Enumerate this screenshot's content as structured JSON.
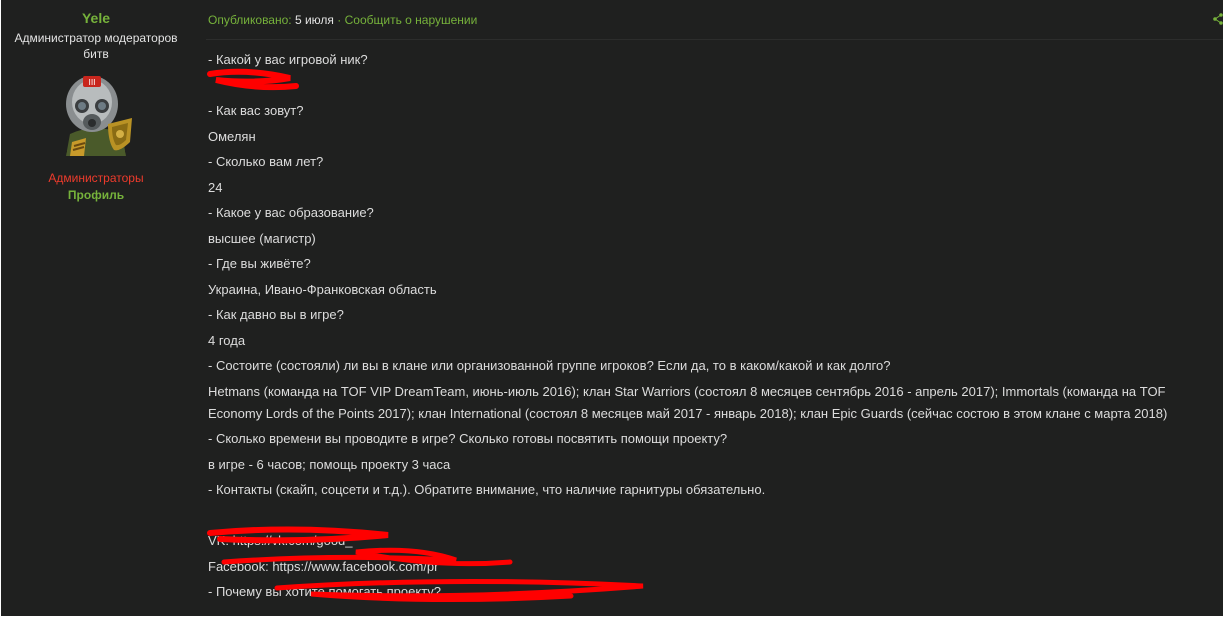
{
  "author": {
    "name": "Yele",
    "title": "Администратор модераторов битв",
    "group": "Администраторы",
    "profile_link": "Профиль"
  },
  "post": {
    "published_label": "Опубликовано:",
    "date": "5 июля",
    "separator": "·",
    "report_link": "Сообщить о нарушении",
    "lines": [
      "- Какой у вас игровой ник?",
      "",
      "-  Как вас зовут?",
      "Омелян",
      "- Сколько вам лет?",
      "24",
      "- Какое у вас образование?",
      "высшее (магистр)",
      "- Где вы живёте?",
      "Украина, Ивано-Франковская область",
      "- Как давно вы в игре?",
      "4 года",
      "- Состоите (состояли) ли вы в клане или организованной группе игроков? Если да, то в каком/какой и как долго?",
      "Hetmans (команда на TOF VIP DreamTeam, июнь-июль 2016); клан Star Warriors (состоял 8 месяцев сентябрь 2016 - апрель 2017); Immortals (команда на TOF Economy Lords of the Points 2017); клан International (состоял 8 месяцев май 2017 - январь 2018); клан Epic Guards (сейчас состою в этом клане с марта 2018)",
      "- Сколько времени вы проводите в игре? Сколько готовы посвятить помощи проекту?",
      "в игре - 6 часов; помощь проекту 3 часа",
      "- Контакты (скайп, соцсети и т.д.). Обратите внимание, что наличие гарнитуры обязательно.",
      "",
      "VK: https://vk.com/good_",
      "Facebook: https://www.facebook.com/pr",
      "- Почему вы хотите помогать проекту?"
    ]
  },
  "colors": {
    "background": "#1f201f",
    "accent_green": "#76b23b",
    "group_red": "#ee3b2c",
    "text": "#dcdcdc",
    "redaction": "#ff0000"
  },
  "icons": {
    "avatar": "soldier-gas-mask-avatar",
    "share": "share-icon"
  }
}
